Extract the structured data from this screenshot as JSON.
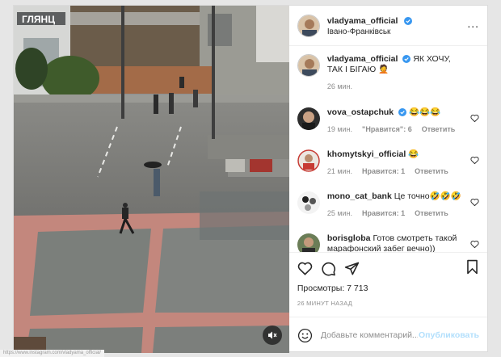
{
  "post": {
    "author": "vladyama_official",
    "location": "Івано-Франківськ",
    "more_label": "...",
    "caption_user": "vladyama_official",
    "caption_text": "ЯК ХОЧУ, ТАК І БІГАЮ 🤦",
    "caption_time": "26 мин."
  },
  "media": {
    "storefront_sign": "ГЛЯНЦ",
    "mute_icon": "speaker-muted-icon"
  },
  "comments": [
    {
      "user": "vova_ostapchuk",
      "verified": true,
      "text": "😂😂😂",
      "time": "19 мин.",
      "likes": "\"Нравится\": 6",
      "reply": "Ответить"
    },
    {
      "user": "khomytskyi_official",
      "verified": false,
      "text": "😂",
      "time": "21 мин.",
      "likes": "Нравится: 1",
      "reply": "Ответить"
    },
    {
      "user": "mono_cat_bank",
      "verified": false,
      "text": "Це точно🤣🤣🤣",
      "time": "25 мин.",
      "likes": "Нравится: 1",
      "reply": "Ответить"
    },
    {
      "user": "borisgloba",
      "verified": false,
      "text": "Готов смотреть такой марафонский забег вечно))",
      "time": "",
      "likes": "",
      "reply": ""
    }
  ],
  "actions": {
    "views_label": "Просмотры: 7 713",
    "time_ago": "26 минут назад"
  },
  "comment_box": {
    "placeholder": "Добавьте комментарий...",
    "publish_label": "Опубликовать"
  },
  "status_bar": {
    "url": "https://www.instagram.com/vladyama_official/"
  },
  "colors": {
    "verified": "#3897f0",
    "publish": "#b2dffc",
    "meta_gray": "#8e8e8e",
    "wet_asphalt": "#808080",
    "brick_pavement": "#b77f74"
  }
}
